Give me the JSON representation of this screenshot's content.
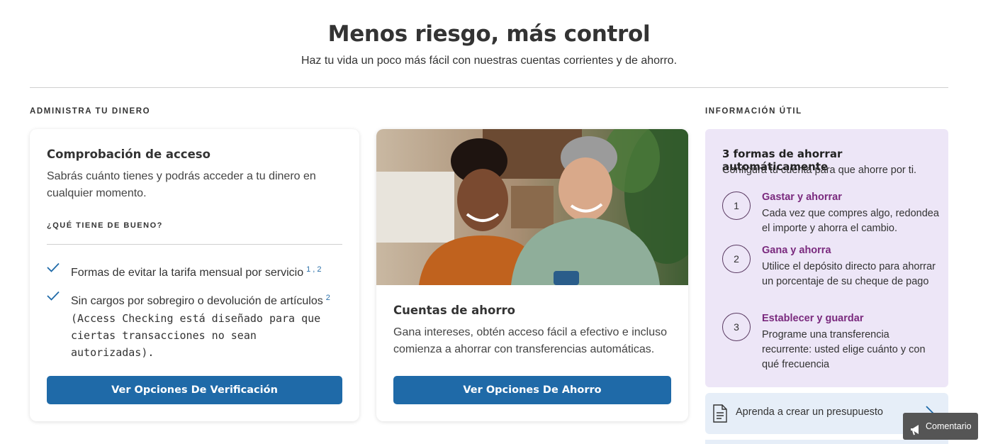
{
  "hero": {
    "title": "Menos riesgo, más control",
    "subtitle": "Haz tu vida un poco más fácil con nuestras cuentas corrientes y de ahorro."
  },
  "sections": {
    "manage_label": "ADMINISTRA TU DINERO",
    "info_label": "INFORMACIÓN ÚTIL"
  },
  "checking_card": {
    "title": "Comprobación de acceso",
    "description": "Sabrás cuánto tienes y podrás acceder a tu dinero en cualquier momento.",
    "benefits_label": "¿QUÉ TIENE DE BUENO?",
    "benefits": [
      {
        "text": "Formas de evitar la tarifa mensual por servicio",
        "sup": "1 , 2",
        "note": ""
      },
      {
        "text": "Sin cargos por sobregiro o devolución de artículos",
        "sup": "2",
        "note": "(Access Checking está diseñado para que ciertas transacciones no sean autorizadas)."
      }
    ],
    "button_label": "Ver Opciones De Verificación"
  },
  "savings_card": {
    "title": "Cuentas de ahorro",
    "description": "Gana intereses, obtén acceso fácil a efectivo e incluso comienza a ahorrar con transferencias automáticas.",
    "button_label": "Ver Opciones De Ahorro"
  },
  "info_panel": {
    "title": "3 formas de ahorrar automáticamente",
    "subtitle": "Configura tu cuenta para que ahorre por ti.",
    "steps": [
      {
        "num": "1",
        "title": "Gastar y ahorrar",
        "desc": "Cada vez que compres algo, redondea el importe y ahorra el cambio."
      },
      {
        "num": "2",
        "title": "Gana y ahorra",
        "desc": "Utilice el depósito directo para ahorrar un porcentaje de su cheque de pago"
      },
      {
        "num": "3",
        "title": "Establecer y guardar",
        "desc": "Programe una transferencia recurrente: usted elige cuánto y con qué frecuencia"
      }
    ]
  },
  "learn_link": {
    "label": "Aprenda a crear un presupuesto",
    "icon": "document-icon"
  },
  "feedback": {
    "label": "Comentario",
    "icon": "megaphone-icon"
  },
  "colors": {
    "primary_button": "#1f6aa8",
    "info_panel_bg": "#ede6f7",
    "step_title": "#7a2a7e",
    "learn_row_bg": "#e6eef8",
    "check": "#1f6aa8"
  }
}
